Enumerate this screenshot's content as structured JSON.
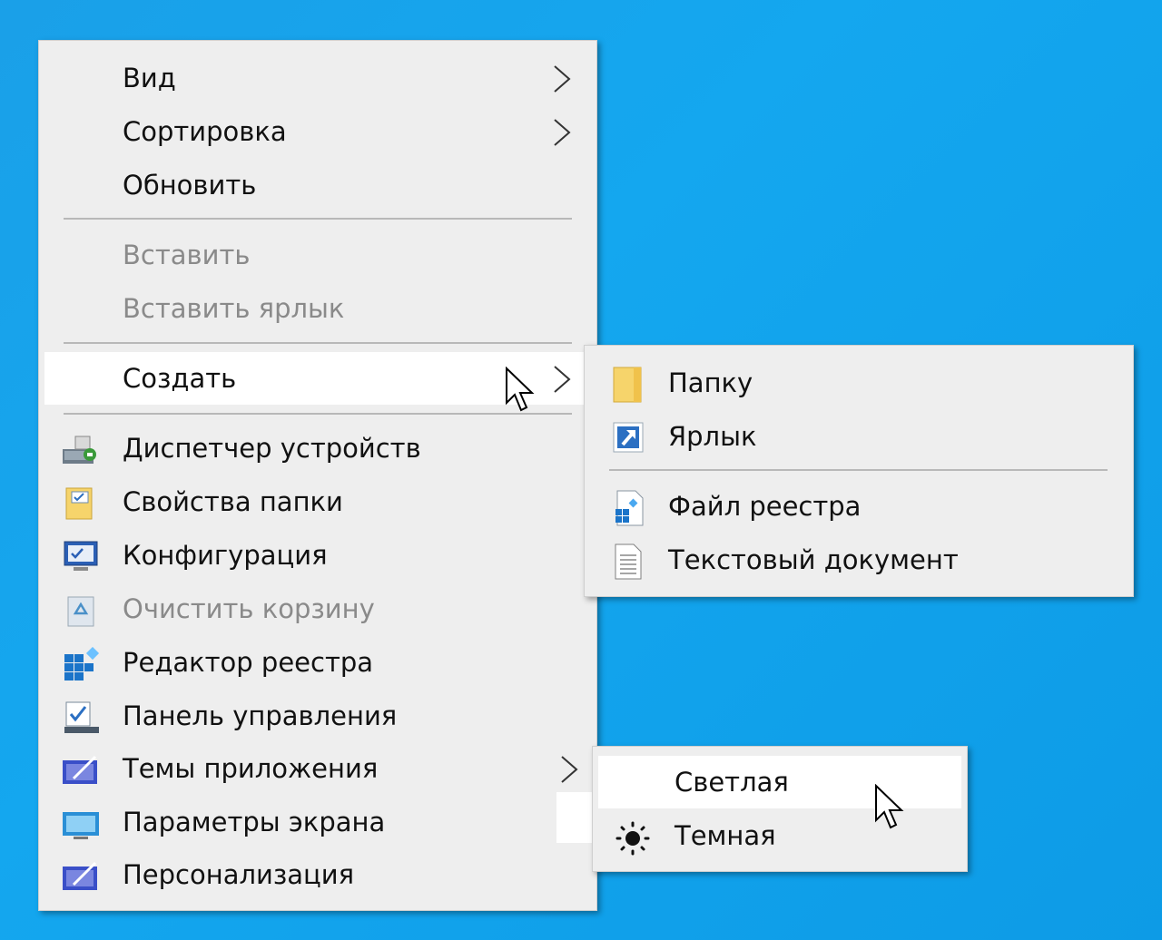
{
  "main_menu": {
    "items": [
      {
        "label": "Вид",
        "submenu": true
      },
      {
        "label": "Сортировка",
        "submenu": true
      },
      {
        "label": "Обновить"
      },
      {
        "label": "Вставить",
        "disabled": true
      },
      {
        "label": "Вставить ярлык",
        "disabled": true
      },
      {
        "label": "Создать",
        "submenu": true,
        "highlighted": true
      },
      {
        "label": "Диспетчер устройств",
        "icon": "device-manager-icon"
      },
      {
        "label": "Свойства папки",
        "icon": "folder-options-icon"
      },
      {
        "label": "Конфигурация",
        "icon": "system-config-icon"
      },
      {
        "label": "Очистить корзину",
        "icon": "recycle-bin-icon",
        "disabled": true
      },
      {
        "label": "Редактор реестра",
        "icon": "registry-editor-icon"
      },
      {
        "label": "Панель управления",
        "icon": "control-panel-icon"
      },
      {
        "label": "Темы приложения",
        "icon": "app-themes-icon",
        "submenu": true
      },
      {
        "label": "Параметры экрана",
        "icon": "display-settings-icon"
      },
      {
        "label": "Персонализация",
        "icon": "personalization-icon"
      }
    ]
  },
  "create_submenu": {
    "items": [
      {
        "label": "Папку",
        "icon": "folder-icon"
      },
      {
        "label": "Ярлык",
        "icon": "shortcut-icon"
      },
      {
        "label": "Файл реестра",
        "icon": "registry-file-icon"
      },
      {
        "label": "Текстовый документ",
        "icon": "text-document-icon"
      }
    ]
  },
  "theme_submenu": {
    "items": [
      {
        "label": "Светлая",
        "highlighted": true
      },
      {
        "label": "Темная",
        "icon": "sun-icon"
      }
    ]
  },
  "colors": {
    "desktop_background": "#14a7ef",
    "menu_background": "#eeeeee",
    "highlight": "#ffffff",
    "disabled_text": "#8a8a8a"
  }
}
